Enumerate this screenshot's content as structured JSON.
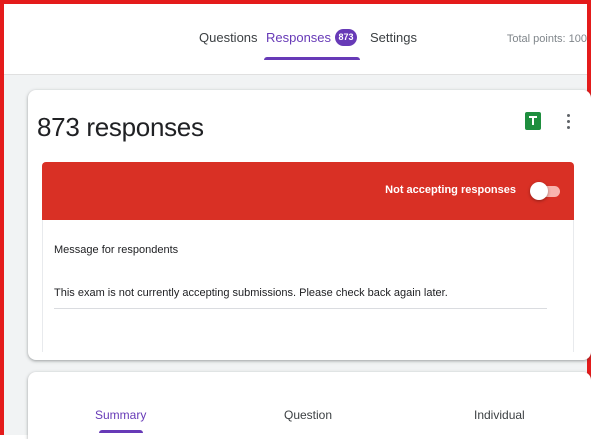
{
  "header": {
    "tabs": [
      {
        "label": "Questions"
      },
      {
        "label": "Responses",
        "badge": "873",
        "active": true
      },
      {
        "label": "Settings"
      }
    ],
    "total_points": "Total points: 100"
  },
  "responses": {
    "count_label": "873 responses",
    "accepting_label": "Not accepting responses",
    "accepting": false,
    "message_label": "Message for respondents",
    "message_text": "This exam is not currently accepting submissions. Please check back again later."
  },
  "subtabs": [
    {
      "label": "Summary",
      "active": true
    },
    {
      "label": "Question"
    },
    {
      "label": "Individual"
    }
  ],
  "icons": {
    "sheets": "sheets-icon",
    "more": "more-vert-icon"
  },
  "colors": {
    "accent": "#673ab7",
    "banner": "#d93025",
    "sheets": "#1e8e3e",
    "frame": "#e41b1b"
  }
}
